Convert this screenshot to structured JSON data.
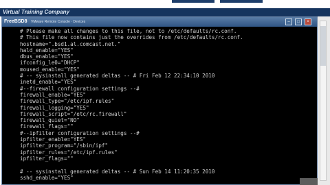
{
  "header": {
    "brand": "Virtual Training Company"
  },
  "window": {
    "title": "FreeBSD8",
    "subtitle": "VMware Remote Console · Devices"
  },
  "terminal": {
    "lines": [
      "# Please make all changes to this file, not to /etc/defaults/rc.conf.",
      "# This file now contains just the overrides from /etc/defaults/rc.conf.",
      "hostname=\".bsd1.al.comcast.net.\"",
      "hald_enable=\"YES\"",
      "dbus_enable=\"YES\"",
      "ifconfig_le0=\"DHCP\"",
      "moused_enable=\"YES\"",
      "# -- sysinstall generated deltas -- # Fri Feb 12 22:34:10 2010",
      "inetd_enable=\"YES\"",
      "#--firewall configuration settings --#",
      "firewall_enable=\"YES\"",
      "firewall_type=\"/etc/ipf.rules\"",
      "firewall_logging=\"YES\"",
      "firewall_script=\"/etc/rc.firewall\"",
      "firewall_quiet=\"NO\"",
      "firewall_flags=\"\"",
      "#--ipfilter configuration settings --#",
      "ipfilter_enable=\"YES\"",
      "ipfilter_program=\"/sbin/ipf\"",
      "ipfilter_rules=\"/etc/ipf.rules\"",
      "ipfilter_flags=\"\"",
      "",
      "# -- sysinstall generated deltas -- # Sun Feb 14 11:20:35 2010",
      "sshd_enable=\"YES\""
    ]
  }
}
